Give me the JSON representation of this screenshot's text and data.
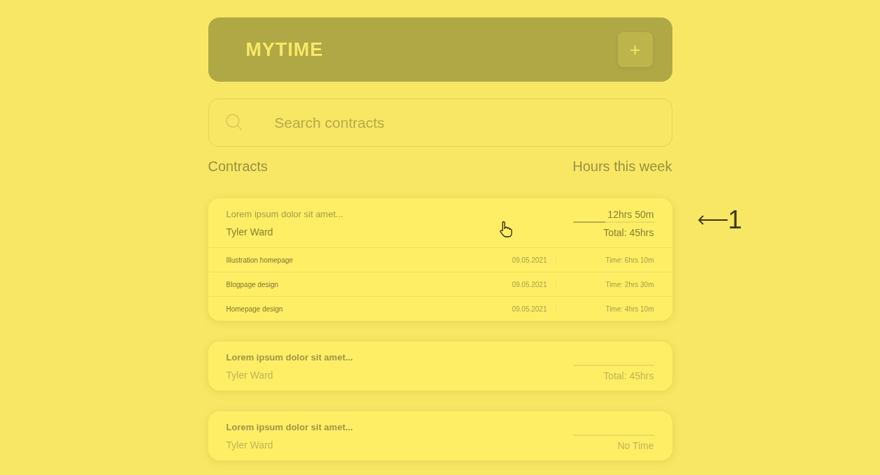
{
  "header": {
    "title": "MYTIME",
    "add_button": "+"
  },
  "search": {
    "placeholder": "Search contracts"
  },
  "list_header": {
    "left": "Contracts",
    "right": "Hours this week"
  },
  "contracts": [
    {
      "title": "Lorem ipsum dolor sit amet...",
      "client": "Tyler Ward",
      "hours": "12hrs 50m",
      "level": 0.4,
      "total": "Total: 45hrs",
      "active": true,
      "tasks": [
        {
          "name": "Illustration  homepage",
          "date": "09.05.2021",
          "time": "Time: 6hrs 10m"
        },
        {
          "name": "Blogpage design",
          "date": "09.05.2021",
          "time": "Time: 2hrs 30m"
        },
        {
          "name": "Homepage design",
          "date": "09.05.2021",
          "time": "Time: 4hrs 10m"
        }
      ]
    },
    {
      "title": "Lorem ipsum dolor sit amet...",
      "client": "Tyler Ward",
      "total": "Total: 45hrs",
      "active": false
    },
    {
      "title": "Lorem ipsum dolor sit amet...",
      "client": "Tyler Ward",
      "total": "No Time",
      "active": false
    }
  ],
  "annotation": {
    "label": "1"
  }
}
